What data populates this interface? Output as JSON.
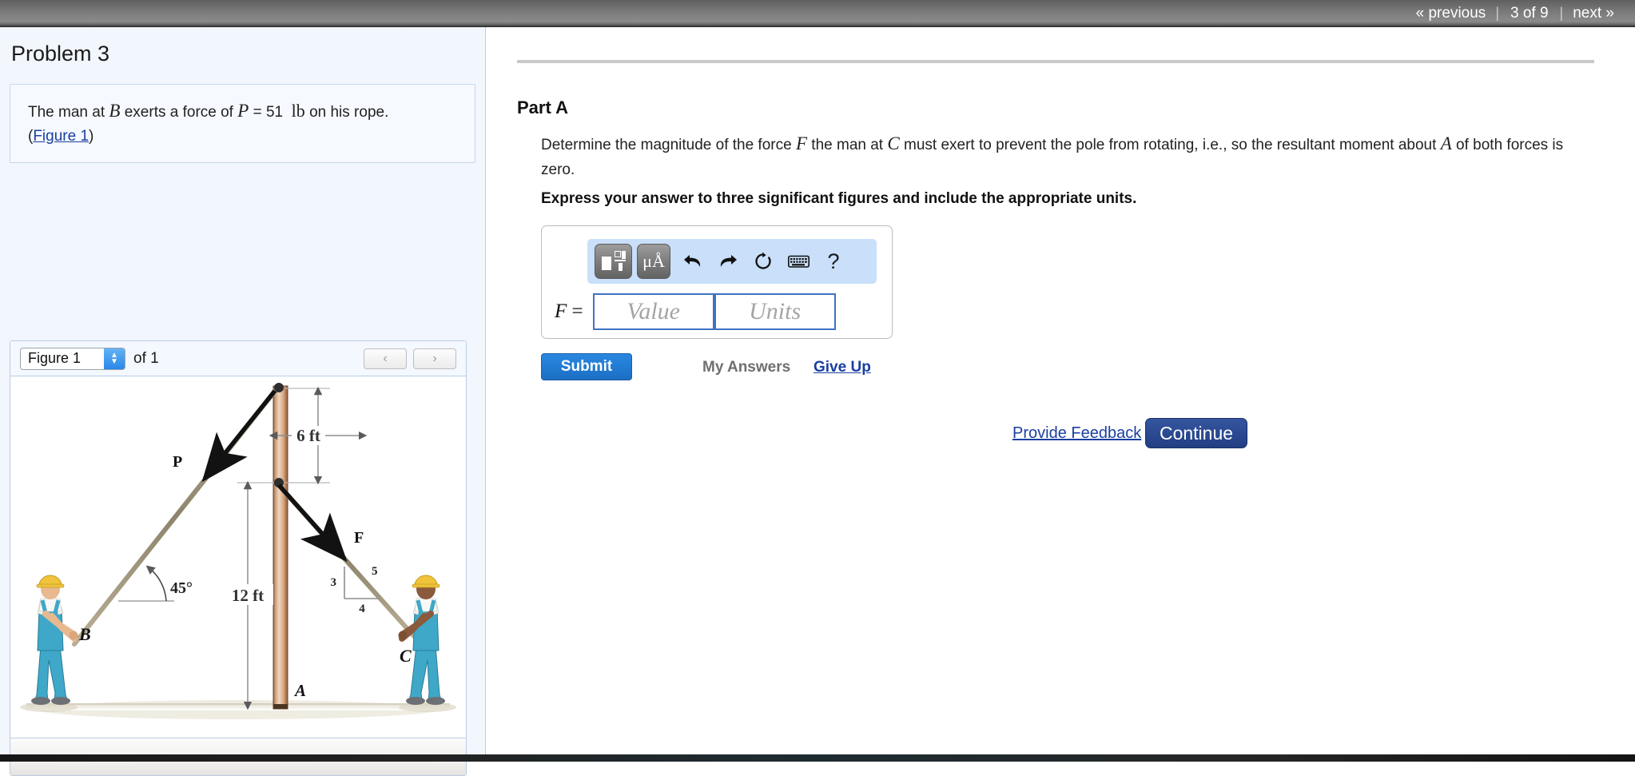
{
  "nav": {
    "previous": "« previous",
    "counter": "3 of 9",
    "next": "next »",
    "separator": "|"
  },
  "sidebar": {
    "problem_title": "Problem 3",
    "statement": {
      "prefix": "The man at ",
      "var_b": "B",
      "mid": " exerts a force of ",
      "var_p": "P",
      "equals": " = 51",
      "unit": "lb",
      "suffix": " on his rope.",
      "paren_open": "(",
      "figure_link": "Figure 1",
      "paren_close": ")"
    },
    "figure_panel": {
      "selected_figure": "Figure 1",
      "of_label": "of 1",
      "prev_arrow": "‹",
      "next_arrow": "›",
      "options": [
        "Figure 1"
      ]
    }
  },
  "main": {
    "part_title": "Part A",
    "question": {
      "t1": "Determine the magnitude of the force ",
      "var_f": "F",
      "t2": " the man at ",
      "var_c": "C",
      "t3": " must exert to prevent the pole from rotating, i.e., so the resultant moment about ",
      "var_a": "A",
      "t4": " of both forces is zero."
    },
    "express_note": "Express your answer to three significant figures and include the appropriate units.",
    "answer": {
      "equation_var": "F",
      "equation_equals": "=",
      "value_placeholder": "Value",
      "units_placeholder": "Units",
      "toolbar": {
        "template_icon": "math-template-icon",
        "units_icon": "μÅ",
        "undo_icon": "undo-icon",
        "redo_icon": "redo-icon",
        "reset_icon": "reset-icon",
        "keyboard_icon": "keyboard-icon",
        "help_icon": "?"
      }
    },
    "submit_label": "Submit",
    "my_answers_label": "My Answers",
    "give_up_label": "Give Up",
    "provide_feedback_label": "Provide Feedback",
    "continue_label": "Continue"
  },
  "figure": {
    "labels": {
      "force_p": "P",
      "force_f": "F",
      "point_a": "A",
      "point_b": "B",
      "point_c": "C",
      "dim_top": "6 ft",
      "dim_bottom": "12 ft",
      "angle": "45°",
      "slope_rise": "3",
      "slope_run": "4",
      "slope_hyp": "5"
    }
  },
  "colors": {
    "accent_blue": "#2a87e0",
    "link_blue": "#1a3fa0",
    "continue_blue": "#34559f",
    "toolbar_blue": "#c9dffa",
    "sidebar_bg": "#f2f6fd",
    "panel_border": "#b9cde4",
    "pole_wood": "#d8a985",
    "worker_overall": "#3fa8c8",
    "hat_yellow": "#efc33b"
  }
}
